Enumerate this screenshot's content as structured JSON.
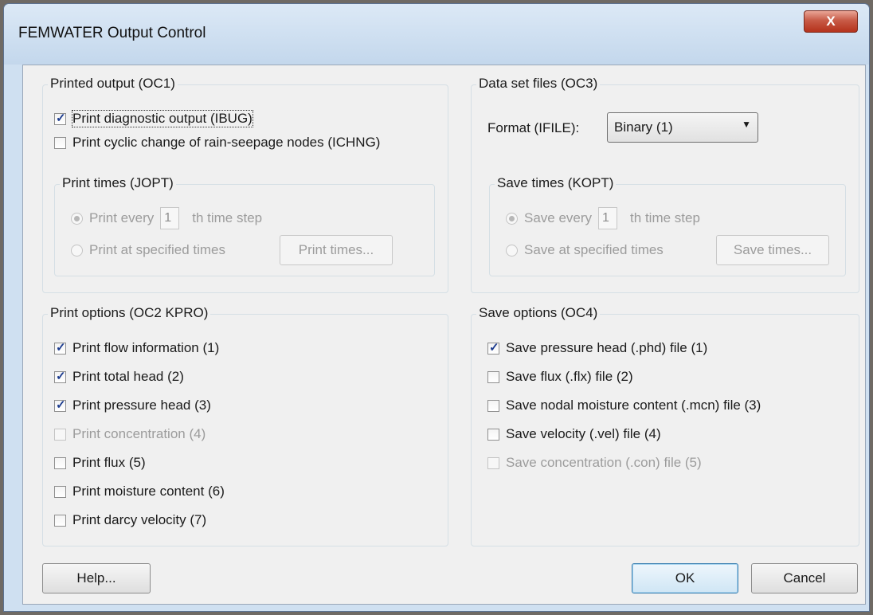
{
  "window": {
    "title": "FEMWATER Output Control",
    "close_label": "X"
  },
  "printed_output": {
    "label": "Printed output (OC1)",
    "checks": [
      {
        "label": "Print diagnostic output (IBUG)",
        "checked": true
      },
      {
        "label": "Print cyclic change of rain-seepage nodes (ICHNG)",
        "checked": false
      }
    ],
    "print_times": {
      "label": "Print times (JOPT)",
      "every_label": "Print every",
      "every_value": "1",
      "step_suffix": "th time step",
      "specified_label": "Print at specified times",
      "button": "Print times..."
    }
  },
  "data_set_files": {
    "label": "Data set files (OC3)",
    "format_label": "Format (IFILE):",
    "format_value": "Binary (1)",
    "save_times": {
      "label": "Save times (KOPT)",
      "every_label": "Save every",
      "every_value": "1",
      "step_suffix": "th time step",
      "specified_label": "Save at specified times",
      "button": "Save times..."
    }
  },
  "print_options": {
    "label": "Print options (OC2 KPRO)",
    "items": [
      {
        "label": "Print flow information (1)",
        "checked": true,
        "enabled": true
      },
      {
        "label": "Print total head (2)",
        "checked": true,
        "enabled": true
      },
      {
        "label": "Print pressure head (3)",
        "checked": true,
        "enabled": true
      },
      {
        "label": "Print concentration (4)",
        "checked": false,
        "enabled": false
      },
      {
        "label": "Print flux (5)",
        "checked": false,
        "enabled": true
      },
      {
        "label": "Print moisture content (6)",
        "checked": false,
        "enabled": true
      },
      {
        "label": "Print darcy velocity (7)",
        "checked": false,
        "enabled": true
      }
    ]
  },
  "save_options": {
    "label": "Save options (OC4)",
    "items": [
      {
        "label": "Save pressure head (.phd) file (1)",
        "checked": true,
        "enabled": true
      },
      {
        "label": "Save flux (.flx) file (2)",
        "checked": false,
        "enabled": true
      },
      {
        "label": "Save nodal moisture content (.mcn) file (3)",
        "checked": false,
        "enabled": true
      },
      {
        "label": "Save velocity (.vel) file (4)",
        "checked": false,
        "enabled": true
      },
      {
        "label": "Save concentration (.con) file (5)",
        "checked": false,
        "enabled": false
      }
    ]
  },
  "buttons": {
    "help": "Help...",
    "ok": "OK",
    "cancel": "Cancel"
  }
}
